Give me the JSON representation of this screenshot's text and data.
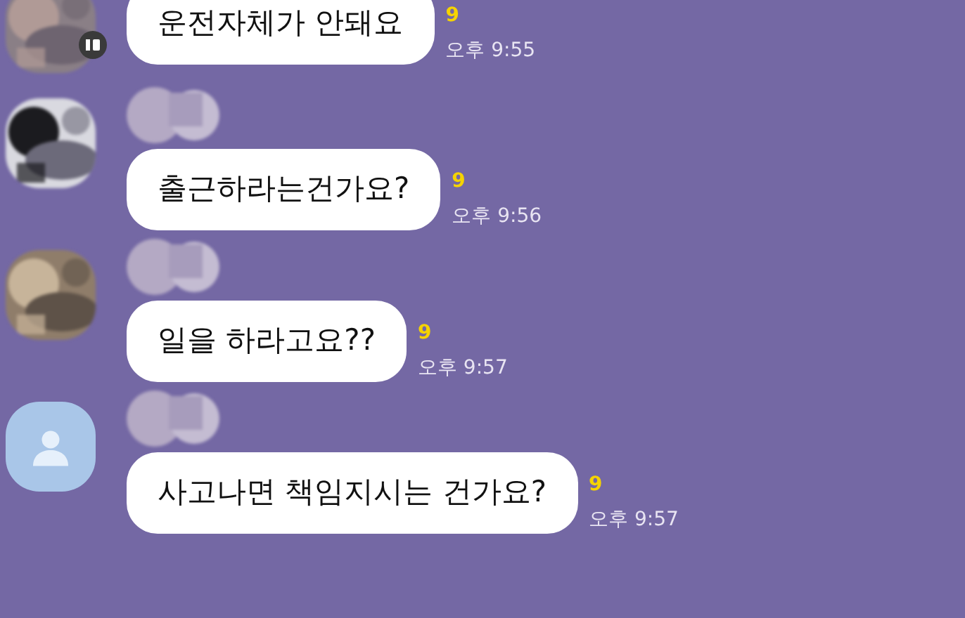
{
  "messages": [
    {
      "has_badge": true,
      "name_hidden": false,
      "text": "운전자체가 안돼요",
      "unread": "9",
      "time": "오후 9:55"
    },
    {
      "has_badge": false,
      "name_hidden": true,
      "text": "출근하라는건가요?",
      "unread": "9",
      "time": "오후 9:56"
    },
    {
      "has_badge": false,
      "name_hidden": true,
      "text": "일을 하라고요??",
      "unread": "9",
      "time": "오후 9:57"
    },
    {
      "avatar": {
        "kind": "default"
      },
      "has_badge": false,
      "name_hidden": true,
      "text": "사고나면 책임지시는 건가요?",
      "unread": "9",
      "time": "오후 9:57"
    }
  ]
}
